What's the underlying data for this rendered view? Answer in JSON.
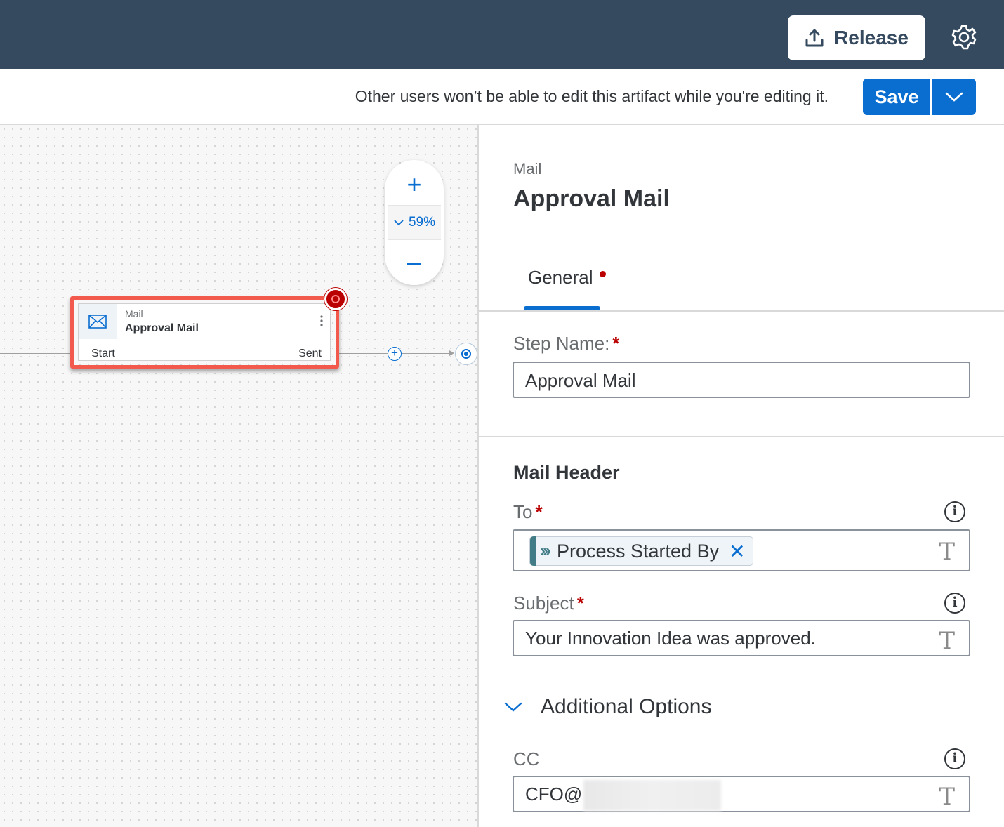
{
  "shell": {
    "release_label": "Release",
    "settings_icon": "gear-icon",
    "release_icon": "upload-icon"
  },
  "toolbar": {
    "edit_notice": "Other users won’t be able to edit this artifact while you're editing it.",
    "save_label": "Save",
    "save_menu_icon": "chevron-down-icon"
  },
  "canvas": {
    "zoom_in_icon": "plus-icon",
    "zoom_out_icon": "minus-icon",
    "zoom_level": "59%",
    "step": {
      "type": "Mail",
      "title": "Approval Mail",
      "start_label": "Start",
      "end_label": "Sent",
      "icon": "envelope-icon",
      "has_error": true
    }
  },
  "panel": {
    "type": "Mail",
    "title": "Approval Mail",
    "tabs": [
      {
        "label": "General",
        "active": true,
        "has_error": true
      }
    ],
    "step_name": {
      "label": "Step Name:",
      "required": "*",
      "value": "Approval Mail"
    },
    "mail_header": {
      "title": "Mail Header",
      "to": {
        "label": "To",
        "required": "*",
        "token": "Process Started By",
        "token_remove": "✕"
      },
      "subject": {
        "label": "Subject",
        "required": "*",
        "value": "Your Innovation Idea was approved."
      }
    },
    "additional_options": {
      "label": "Additional Options",
      "expanded": true,
      "cc": {
        "label": "CC",
        "value": "CFO@"
      }
    },
    "text_type_glyph": "T",
    "info_glyph": "i"
  },
  "colors": {
    "shell_bg": "#354a5f",
    "accent": "#0a6ed1",
    "error": "#bb0000",
    "highlight": "#f25a4e"
  }
}
